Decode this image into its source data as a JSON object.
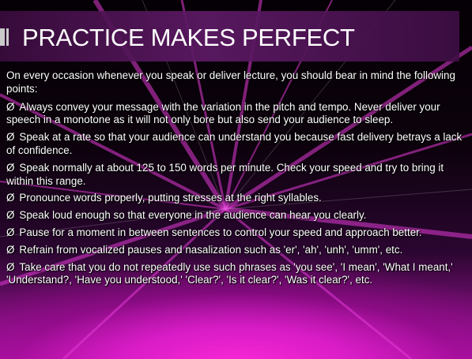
{
  "slide": {
    "title": "PRACTICE MAKES PERFECT",
    "intro": "On every occasion whenever you speak or deliver lecture, you should bear in mind the following points:",
    "bullet_symbol": "Ø",
    "bullets": [
      "Always convey your message with the variation in the pitch and tempo. Never deliver your speech in a monotone as it will not only bore but also send your audience to sleep.",
      "Speak at a rate so that your audience can understand you because fast delivery betrays a lack of confidence.",
      "Speak normally at about 125 to 150 words per minute. Check your speed and try to bring it within this range.",
      "Pronounce words properly, putting stresses at the right syllables.",
      "Speak loud enough so that everyone in the audience can hear you clearly.",
      "Pause for a moment in between sentences to control your speed and approach better.",
      "Refrain from vocalized pauses and nasalization such as 'er', 'ah', 'unh', 'umm', etc.",
      "Take care that you do not repeatedly use such phrases as 'you see', 'I mean', 'What I meant,' 'Understand?, 'Have you understood,' 'Clear?', 'Is it clear?', 'Was it clear?', etc."
    ]
  },
  "colors": {
    "background": "#000000",
    "glow": "#ff2ad8",
    "title_band": "#5e1a66",
    "text": "#ffffff"
  }
}
